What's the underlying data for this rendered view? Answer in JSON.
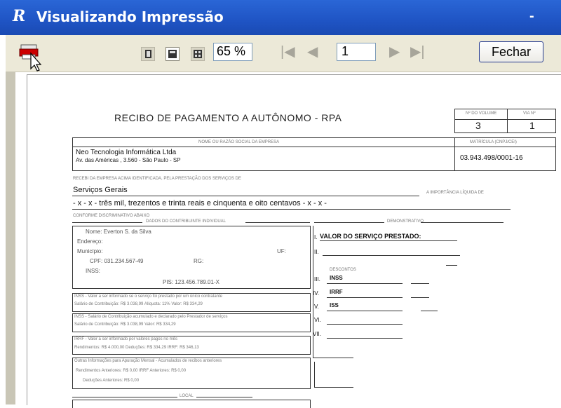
{
  "window": {
    "title": "Visualizando Impressão",
    "app_icon": "R",
    "minimize": "-"
  },
  "toolbar": {
    "zoom": "65 %",
    "page": "1",
    "close_label": "Fechar",
    "nav_first": "|◀",
    "nav_prev": "◀",
    "nav_next": "▶",
    "nav_last": "▶|"
  },
  "doc": {
    "title": "RECIBO DE PAGAMENTO A AUTÔNOMO - RPA",
    "hdr_vol_label": "Nº DO VOLUME",
    "hdr_vol_value": "3",
    "hdr_via_label": "VIA Nº",
    "hdr_via_value": "1",
    "razao_label": "NOME OU RAZÃO SOCIAL DA EMPRESA",
    "matricula_label": "MATRÍCULA (CNPJ/CEI)",
    "empresa_nome": "Neo Tecnologia Informática Ltda",
    "empresa_end": "Av. das Américas , 3.560 - São Paulo - SP",
    "cnpj": "03.943.498/0001-16",
    "recebi_label": "RECEBI DA EMPRESA ACIMA IDENTIFICADA, PELA PRESTAÇÃO DOS SERVIÇOS DE",
    "servicos": "Serviços Gerais",
    "liquida_label": "A IMPORTÂNCIA LÍQUIDA DE",
    "extenso": "- x - x - três mil, trezentos e trinta reais e cinquenta e oito centavos - x - x -",
    "conforme_label": "CONFORME DISCRIMINATIVO ABAIXO",
    "dados_label": "DADOS DO CONTRIBUINTE INDIVIDUAL",
    "demonstrativo_label": "DEMONSTRATIVO",
    "nome_line": "Nome: Everton S. da Silva",
    "endereco_label": "Endereço:",
    "municipio_label": "Município:",
    "uf_label": "UF:",
    "cpf_line": "CPF: 031.234.567-49",
    "rg_label": "RG:",
    "inss_label": "INSS:",
    "pis_line": "PIS: 123.456.789.01-X",
    "box1_l1": "INSS - Valor a ser informado se o serviço foi prestado por um único contratante",
    "box1_l2": "Salário de Contribuição: R$ 3.038,99          Alíquota: 11%        Valor: R$ 334,29",
    "box2_l1": "INSS - Salário de Contribuição acumulado e declarado pelo Prestador de serviços",
    "box2_l2": "Salário de Contribuição: R$ 3.038,99                                      Valor: R$ 334,29",
    "box3_l1": "IRRF - Valor a ser informado por valores pagos no mês",
    "box3_l2": "Rendimentos: R$ 4.000,00          Deduções: R$ 334,29        IRRF: R$ 346,13",
    "box4_l1": "Outras Informações para Apuração Mensal - Acumulados de recibos anteriores",
    "box4_l2": "Rendimentos Anteriores: R$ 0,00                                     IRRF Anteriores: R$ 0,00",
    "box4_l3": "Deduções Anteriores: R$ 0,00",
    "local_label": "LOCAL",
    "valor_servico": "VALOR DO SERVIÇO PRESTADO:",
    "descontos_label": "DESCONTOS",
    "roman_I": "I.",
    "roman_II": "II.",
    "roman_III": "III.",
    "roman_IV": "IV.",
    "roman_V": "V.",
    "roman_VI": "VI.",
    "roman_VII": "VII.",
    "d_inss": "INSS",
    "d_irrf": "IRRF",
    "d_iss": "ISS"
  }
}
